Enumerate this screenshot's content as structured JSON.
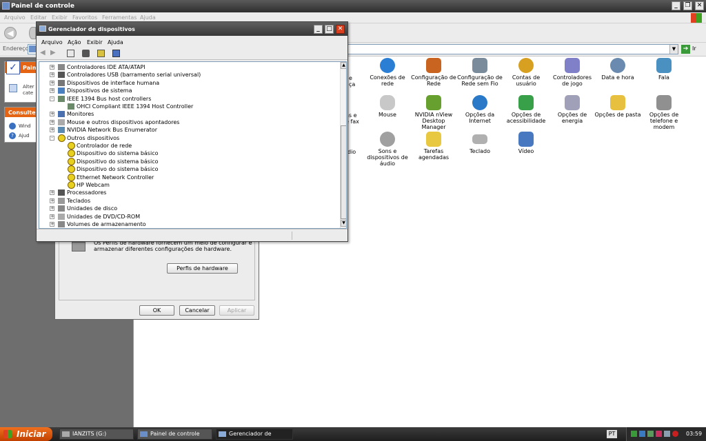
{
  "window": {
    "title": "Painel de controle",
    "menu": [
      "Arquivo",
      "Editar",
      "Exibir",
      "Favoritos",
      "Ferramentas",
      "Ajuda"
    ],
    "address_label": "Endereço",
    "go_label": "Ir"
  },
  "left_panel": {
    "section1_title": "Painel",
    "section1_text": [
      "Alter",
      "cate"
    ],
    "section2_title": "Consulte",
    "section2_links": [
      "Wind",
      "Ajud"
    ]
  },
  "icons": [
    {
      "label": "Conexões de rede",
      "color": "#2a7fd4"
    },
    {
      "label": "Configuração de Rede",
      "color": "#c86420"
    },
    {
      "label": "Configuração de Rede sem Fio",
      "color": "#7a8c9c"
    },
    {
      "label": "Contas de usuário",
      "color": "#d8a020"
    },
    {
      "label": "Controladores de jogo",
      "color": "#8080c8"
    },
    {
      "label": "Data e hora",
      "color": "#6a8ab0"
    },
    {
      "label": "Fala",
      "color": "#4a90c0"
    },
    {
      "label": "Mouse",
      "color": "#c8c8c8"
    },
    {
      "label": "NVIDIA nView Desktop Manager",
      "color": "#68a030"
    },
    {
      "label": "Opções da Internet",
      "color": "#2a78c8"
    },
    {
      "label": "Opções de acessibilidade",
      "color": "#38a048"
    },
    {
      "label": "Opções de energia",
      "color": "#a0a0b8"
    },
    {
      "label": "Opções de pasta",
      "color": "#e8c040"
    },
    {
      "label": "Opções de telefone e modem",
      "color": "#909090"
    },
    {
      "label": "Sons e dispositivos de áudio",
      "color": "#a0a0a0"
    },
    {
      "label": "Tarefas agendadas",
      "color": "#e8c840"
    },
    {
      "label": "Teclado",
      "color": "#b0b0b0"
    },
    {
      "label": "Vídeo",
      "color": "#4878c0"
    }
  ],
  "partial_labels": [
    "e",
    "ça",
    "as e",
    "e fax",
    "dio"
  ],
  "hardware_dialog": {
    "text_line1": "Os Perfis de hardware fornecem um meio de configurar e",
    "text_line2": "armazenar diferentes configurações de hardware.",
    "profiles_button": "Perfis de hardware",
    "ok": "OK",
    "cancel": "Cancelar",
    "apply": "Aplicar"
  },
  "device_manager": {
    "title": "Gerenciador de dispositivos",
    "menu": [
      "Arquivo",
      "Ação",
      "Exibir",
      "Ajuda"
    ],
    "tree": [
      {
        "label": "Controladores IDE ATA/ATAPI",
        "level": 0,
        "expander": "+",
        "icon": "ide"
      },
      {
        "label": "Controladores USB (barramento serial universal)",
        "level": 0,
        "expander": "+",
        "icon": "usb"
      },
      {
        "label": "Dispositivos de interface humana",
        "level": 0,
        "expander": "+",
        "icon": "hid"
      },
      {
        "label": "Dispositivos de sistema",
        "level": 0,
        "expander": "+",
        "icon": "system"
      },
      {
        "label": "IEEE 1394 Bus host controllers",
        "level": 0,
        "expander": "-",
        "icon": "ieee"
      },
      {
        "label": "OHCI Compliant IEEE 1394 Host Controller",
        "level": 1,
        "expander": "",
        "icon": "ieee"
      },
      {
        "label": "Monitores",
        "level": 0,
        "expander": "+",
        "icon": "monitor"
      },
      {
        "label": "Mouse e outros dispositivos apontadores",
        "level": 0,
        "expander": "+",
        "icon": "mouse"
      },
      {
        "label": "NVIDIA Network Bus Enumerator",
        "level": 0,
        "expander": "+",
        "icon": "network"
      },
      {
        "label": "Outros dispositivos",
        "level": 0,
        "expander": "-",
        "icon": "warning"
      },
      {
        "label": "Controlador de rede",
        "level": 1,
        "expander": "",
        "icon": "warning"
      },
      {
        "label": "Dispositivo do sistema básico",
        "level": 1,
        "expander": "",
        "icon": "warning"
      },
      {
        "label": "Dispositivo do sistema básico",
        "level": 1,
        "expander": "",
        "icon": "warning"
      },
      {
        "label": "Dispositivo do sistema básico",
        "level": 1,
        "expander": "",
        "icon": "warning"
      },
      {
        "label": "Ethernet Network Controller",
        "level": 1,
        "expander": "",
        "icon": "warning"
      },
      {
        "label": "HP Webcam",
        "level": 1,
        "expander": "",
        "icon": "warning"
      },
      {
        "label": "Processadores",
        "level": 0,
        "expander": "+",
        "icon": "cpu"
      },
      {
        "label": "Teclados",
        "level": 0,
        "expander": "+",
        "icon": "keyboard"
      },
      {
        "label": "Unidades de disco",
        "level": 0,
        "expander": "+",
        "icon": "disk"
      },
      {
        "label": "Unidades de DVD/CD-ROM",
        "level": 0,
        "expander": "+",
        "icon": "cdrom"
      },
      {
        "label": "Volumes de armazenamento",
        "level": 0,
        "expander": "+",
        "icon": "disk"
      }
    ]
  },
  "taskbar": {
    "start_label": "Iniciar",
    "tasks": [
      "IANZITS (G:)",
      "Painel de controle",
      "Gerenciador de dispo..."
    ],
    "lang": "PT",
    "clock": "03:59"
  }
}
